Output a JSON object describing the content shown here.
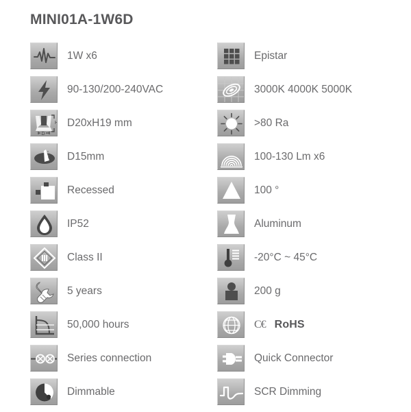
{
  "title": "MINI01A-1W6D",
  "colors": {
    "title_text": "#58585a",
    "label_text": "#6a6a6c",
    "tile_light": "#cfcfcf",
    "tile_dark": "#9d9d9d",
    "glyph_white": "#ffffff",
    "glyph_dark": "#5a5a5a",
    "background": "#ffffff"
  },
  "left_column": [
    {
      "icon": "waveform-power-icon",
      "label": "1W x6"
    },
    {
      "icon": "lightning-voltage-icon",
      "label": "90-130/200-240VAC"
    },
    {
      "icon": "dimensions-icon",
      "label": "D20xH19 mm"
    },
    {
      "icon": "cutout-hole-icon",
      "label": "D15mm"
    },
    {
      "icon": "recessed-mount-icon",
      "label": "Recessed"
    },
    {
      "icon": "water-drop-ip-icon",
      "label": "IP52"
    },
    {
      "icon": "class-two-icon",
      "label": "Class II"
    },
    {
      "icon": "warranty-wrench-icon",
      "label": "5 years"
    },
    {
      "icon": "lifetime-curve-icon",
      "label": "50,000 hours"
    },
    {
      "icon": "series-connection-icon",
      "label": "Series connection"
    },
    {
      "icon": "dimmer-knob-icon",
      "label": "Dimmable"
    }
  ],
  "right_column": [
    {
      "icon": "led-chip-grid-icon",
      "label": "Epistar"
    },
    {
      "icon": "color-temperature-icon",
      "label": "3000K 4000K 5000K"
    },
    {
      "icon": "sun-cri-icon",
      "label": ">80 Ra"
    },
    {
      "icon": "luminous-flux-icon",
      "label": "100-130 Lm x6"
    },
    {
      "icon": "beam-angle-icon",
      "label": "100 °"
    },
    {
      "icon": "aluminum-material-icon",
      "label": "Aluminum"
    },
    {
      "icon": "thermometer-icon",
      "label": "-20°C ~ 45°C"
    },
    {
      "icon": "weight-icon",
      "label": "200 g"
    },
    {
      "icon": "globe-certification-icon",
      "label": "",
      "certifications": {
        "ce": "C€",
        "rohs": "RoHS"
      }
    },
    {
      "icon": "quick-connector-icon",
      "label": "Quick Connector"
    },
    {
      "icon": "scr-waveform-icon",
      "label": "SCR Dimming"
    }
  ]
}
